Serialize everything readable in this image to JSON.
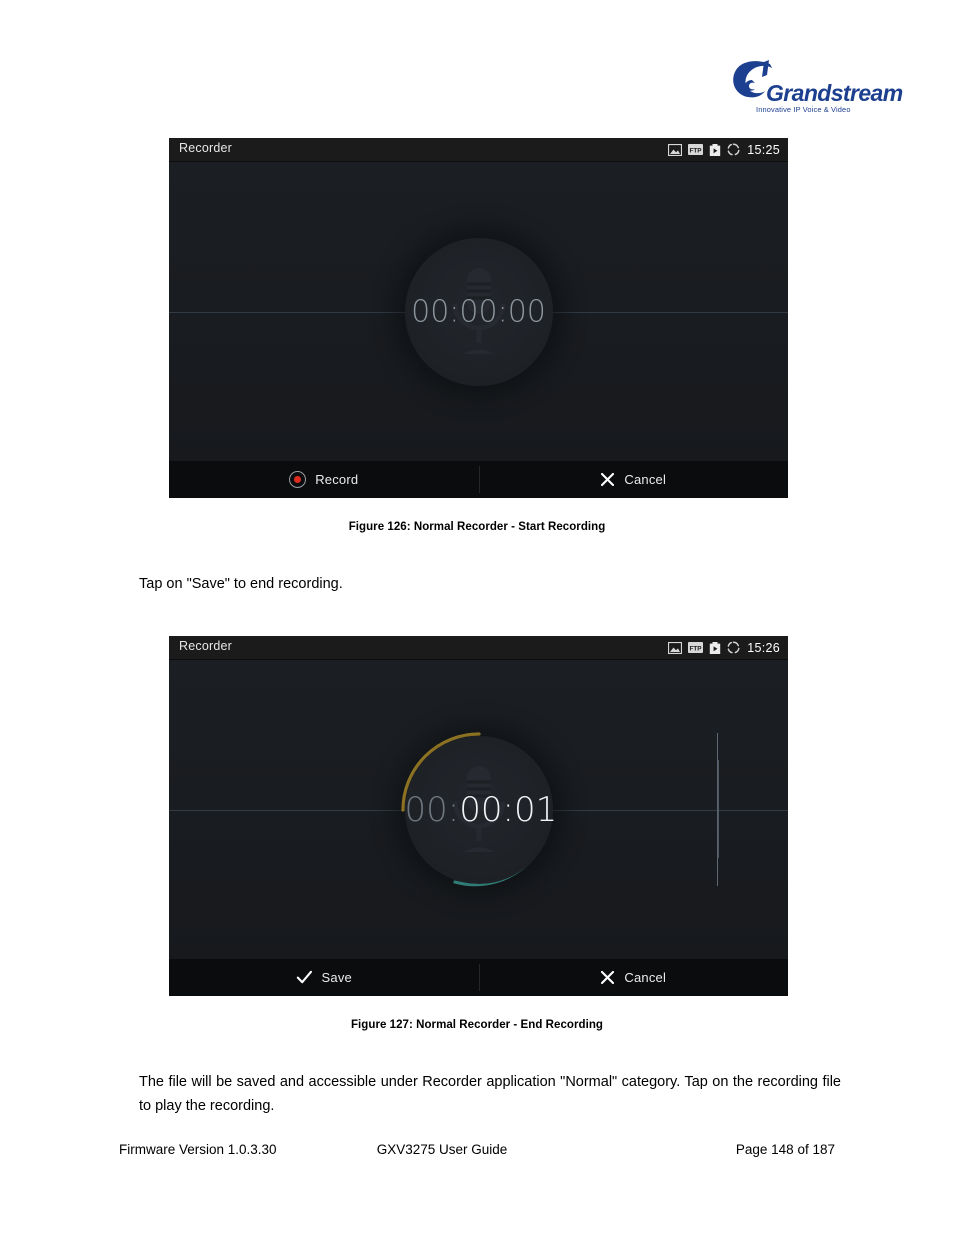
{
  "brand": {
    "name": "Grandstream",
    "tagline": "Innovative IP Voice & Video",
    "logo_color": "#1d3f8f",
    "logo_icon": "grandstream-g-logo"
  },
  "figures": [
    {
      "id": "figure-126",
      "caption": "Figure 126: Normal Recorder - Start Recording",
      "screenshot": {
        "statusbar": {
          "title": "Recorder",
          "clock": "15:25",
          "icons": [
            "image-icon",
            "ftp-icon",
            "screenshot-icon",
            "sync-spinner-icon"
          ]
        },
        "timer": {
          "dim_part": "",
          "bright_part": "",
          "full": "00:00:00"
        },
        "mic_icon": "microphone-icon",
        "ring": {
          "visible": false,
          "arc_colors": []
        },
        "buttons": [
          {
            "label": "Record",
            "icon": "record-dot-icon"
          },
          {
            "label": "Cancel",
            "icon": "close-x-icon"
          }
        ]
      }
    },
    {
      "id": "figure-127",
      "caption": "Figure 127: Normal Recorder - End Recording",
      "screenshot": {
        "statusbar": {
          "title": "Recorder",
          "clock": "15:26",
          "icons": [
            "image-icon",
            "ftp-icon",
            "screenshot-icon",
            "sync-spinner-icon"
          ]
        },
        "timer": {
          "dim_part": "00:",
          "bright_part": "00:01",
          "full": "00:00:01"
        },
        "mic_icon": "microphone-icon",
        "ring": {
          "visible": true,
          "arc_colors": [
            "#e8b931",
            "#4ecdc0"
          ]
        },
        "buttons": [
          {
            "label": "Save",
            "icon": "check-icon"
          },
          {
            "label": "Cancel",
            "icon": "close-x-icon"
          }
        ]
      }
    }
  ],
  "paragraphs": {
    "intro": "Tap on \"Save\" to end recording.",
    "outro": "The file will be saved and accessible under Recorder application \"Normal\" category. Tap on the recording file to play the recording."
  },
  "footer": {
    "firmware": "Firmware Version 1.0.3.30",
    "guide": "GXV3275 User Guide",
    "page": "Page 148 of 187"
  }
}
